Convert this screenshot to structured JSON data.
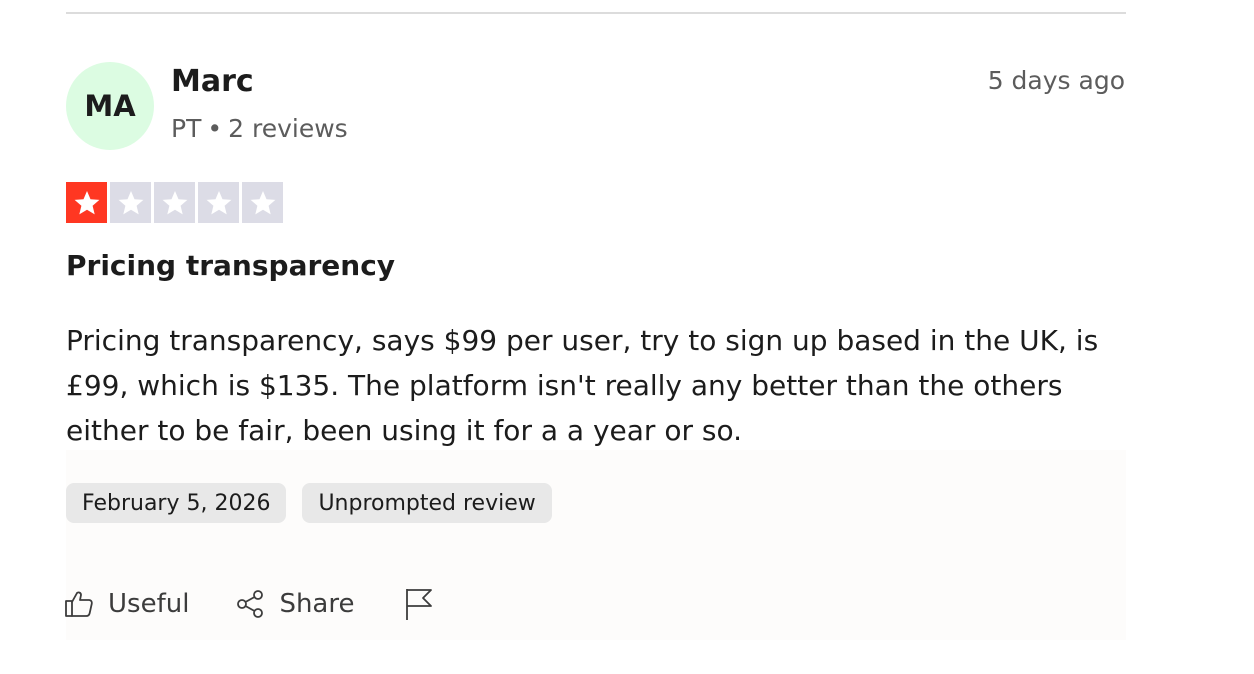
{
  "reviewer": {
    "initials": "MA",
    "name": "Marc",
    "country": "PT",
    "separator": "•",
    "review_count": "2 reviews",
    "avatar_color": "#dcfce2"
  },
  "relative_date": "5 days ago",
  "rating": {
    "value": 1,
    "max": 5,
    "filled_color": "#ff3722",
    "empty_color": "#dcdce6"
  },
  "review": {
    "title": "Pricing transparency",
    "body": "Pricing transparency, says $99 per user, try to sign up based in the UK, is £99, which is $135. The platform isn't really any better than the others either to be fair, been using it for a a year or so."
  },
  "tags": {
    "date": "February 5, 2026",
    "type": "Unprompted review"
  },
  "actions": {
    "useful_label": "Useful",
    "share_label": "Share",
    "useful_icon": "thumbs-up-icon",
    "share_icon": "share-icon",
    "report_icon": "flag-icon"
  }
}
